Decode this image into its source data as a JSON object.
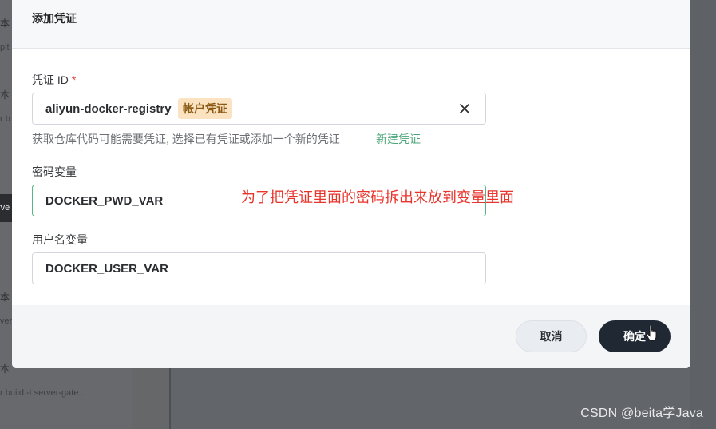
{
  "background": {
    "left_fragments": [
      "本",
      "pit",
      "本",
      "r b",
      "本",
      "ver",
      "本",
      "r build -t server-gate..."
    ],
    "left_bar_text": "rve",
    "watermark": "CSDN @beita学Java"
  },
  "dialog": {
    "title": "添加凭证",
    "credential_id": {
      "label": "凭证 ID",
      "required_mark": "*",
      "value": "aliyun-docker-registry",
      "tag": "帐户凭证"
    },
    "help_text": "获取仓库代码可能需要凭证, 选择已有凭证或添加一个新的凭证",
    "new_credential_link": "新建凭证",
    "password_variable": {
      "label": "密码变量",
      "value": "DOCKER_PWD_VAR"
    },
    "username_variable": {
      "label": "用户名变量",
      "value": "DOCKER_USER_VAR"
    },
    "annotation": "为了把凭证里面的密码拆出来放到变量里面",
    "buttons": {
      "cancel": "取消",
      "confirm": "确定"
    }
  },
  "colors": {
    "accent_green": "#4ba57a",
    "focus_border": "#58b28a",
    "tag_bg": "#fbe3c1",
    "tag_text": "#8a5a14",
    "annotation_red": "#e8352c",
    "primary_button": "#202833"
  }
}
